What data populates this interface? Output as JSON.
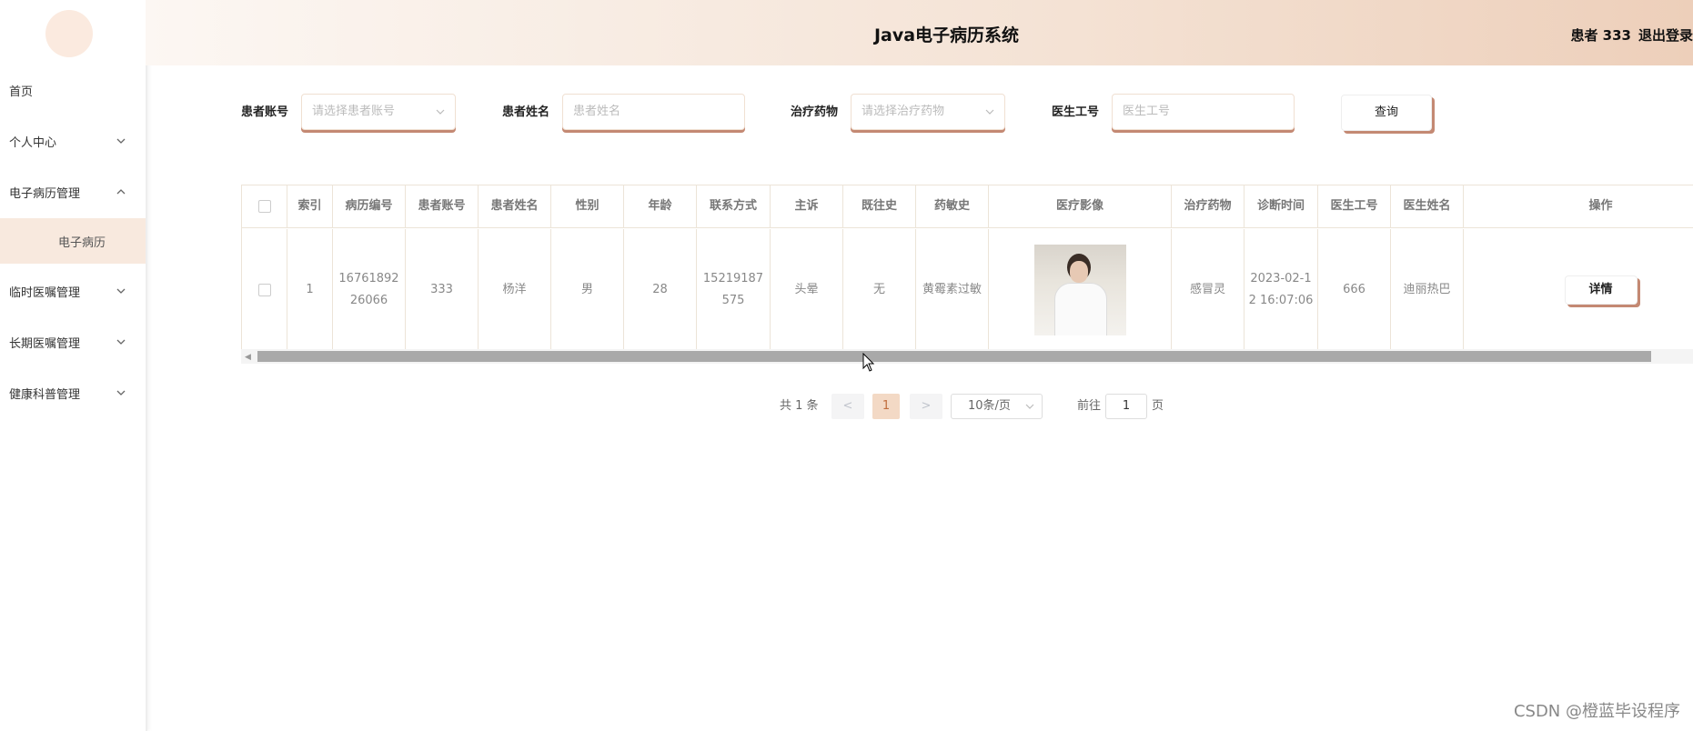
{
  "header": {
    "title": "Java电子病历系统",
    "user": "患者 333",
    "logout": "退出登录"
  },
  "sidebar": {
    "items": [
      {
        "label": "首页"
      },
      {
        "label": "个人中心"
      },
      {
        "label": "电子病历管理"
      },
      {
        "label": "电子病历"
      },
      {
        "label": "临时医嘱管理"
      },
      {
        "label": "长期医嘱管理"
      },
      {
        "label": "健康科普管理"
      }
    ]
  },
  "search": {
    "patient_account_label": "患者账号",
    "patient_account_placeholder": "请选择患者账号",
    "patient_name_label": "患者姓名",
    "patient_name_placeholder": "患者姓名",
    "drug_label": "治疗药物",
    "drug_placeholder": "请选择治疗药物",
    "doctor_id_label": "医生工号",
    "doctor_id_placeholder": "医生工号",
    "query_button": "查询"
  },
  "table": {
    "columns": [
      "索引",
      "病历编号",
      "患者账号",
      "患者姓名",
      "性别",
      "年龄",
      "联系方式",
      "主诉",
      "既往史",
      "药敏史",
      "医疗影像",
      "治疗药物",
      "诊断时间",
      "医生工号",
      "医生姓名",
      "操作"
    ],
    "rows": [
      {
        "index": "1",
        "record_no": "1676189226066",
        "account": "333",
        "name": "杨洋",
        "gender": "男",
        "age": "28",
        "phone": "15219187575",
        "complaint": "头晕",
        "history": "无",
        "allergy": "黄霉素过敏",
        "drug": "感冒灵",
        "diag_time": "2023-02-12 16:07:06",
        "doctor_id": "666",
        "doctor_name": "迪丽热巴",
        "action": "详情"
      }
    ]
  },
  "pagination": {
    "total": "共 1 条",
    "prev": "<",
    "page": "1",
    "next": ">",
    "page_size": "10条/页",
    "goto_prefix": "前往",
    "goto_value": "1",
    "goto_suffix": "页"
  },
  "watermark": "CSDN @橙蓝毕设程序",
  "colors": {
    "accent": "#c48973",
    "header_start": "#fcf7f3",
    "header_end": "#edcfba",
    "active_page": "#f3d9c5"
  }
}
